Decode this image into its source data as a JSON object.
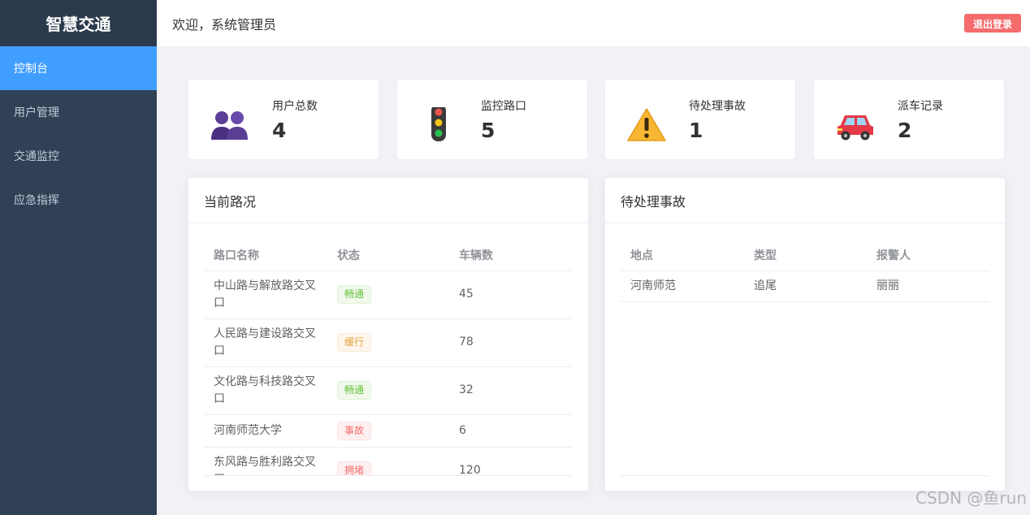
{
  "sidebar": {
    "brand": "智慧交通",
    "items": [
      {
        "label": "控制台",
        "active": true
      },
      {
        "label": "用户管理",
        "active": false
      },
      {
        "label": "交通监控",
        "active": false
      },
      {
        "label": "应急指挥",
        "active": false
      }
    ]
  },
  "header": {
    "welcome": "欢迎，系统管理员",
    "logout_label": "退出登录"
  },
  "stats": [
    {
      "label": "用户总数",
      "value": "4",
      "icon": "users-icon"
    },
    {
      "label": "监控路口",
      "value": "5",
      "icon": "traffic-light-icon"
    },
    {
      "label": "待处理事故",
      "value": "1",
      "icon": "warning-icon"
    },
    {
      "label": "派车记录",
      "value": "2",
      "icon": "car-icon"
    }
  ],
  "traffic_panel": {
    "title": "当前路况",
    "columns": [
      "路口名称",
      "状态",
      "车辆数"
    ],
    "rows": [
      {
        "name": "中山路与解放路交叉口",
        "status": "畅通",
        "status_type": "success",
        "count": "45"
      },
      {
        "name": "人民路与建设路交叉口",
        "status": "缓行",
        "status_type": "warning",
        "count": "78"
      },
      {
        "name": "文化路与科技路交叉口",
        "status": "畅通",
        "status_type": "success",
        "count": "32"
      },
      {
        "name": "河南师范大学",
        "status": "事故",
        "status_type": "danger",
        "count": "6"
      },
      {
        "name": "东风路与胜利路交叉口",
        "status": "拥堵",
        "status_type": "danger",
        "count": "120"
      }
    ]
  },
  "accident_panel": {
    "title": "待处理事故",
    "columns": [
      "地点",
      "类型",
      "报警人"
    ],
    "rows": [
      {
        "location": "河南师范",
        "type": "追尾",
        "reporter": "丽丽"
      }
    ]
  },
  "watermark": "CSDN @鱼run",
  "colors": {
    "sidebar_bg": "#304156",
    "active_menu": "#409eff",
    "logout": "#f56c6c"
  }
}
